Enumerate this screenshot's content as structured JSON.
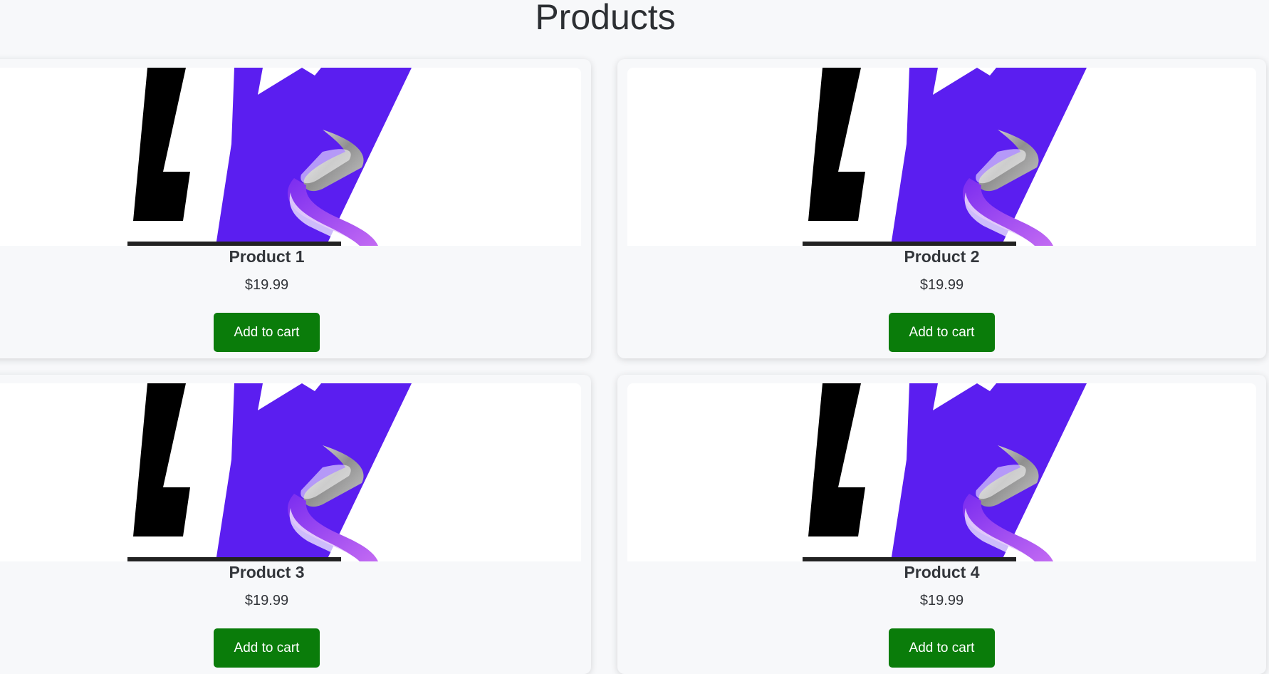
{
  "page": {
    "title": "Products"
  },
  "products": [
    {
      "name": "Product 1",
      "price": "$19.99",
      "button_label": "Add to cart",
      "image_icon": "lw-logo-icon"
    },
    {
      "name": "Product 2",
      "price": "$19.99",
      "button_label": "Add to cart",
      "image_icon": "lw-logo-icon"
    },
    {
      "name": "Product 3",
      "price": "$19.99",
      "button_label": "Add to cart",
      "image_icon": "lw-logo-icon"
    },
    {
      "name": "Product 4",
      "price": "$19.99",
      "button_label": "Add to cart",
      "image_icon": "lw-logo-icon"
    }
  ],
  "colors": {
    "background": "#f7f8fa",
    "button": "#0a7c0a",
    "logo_purple": "#5b1ef0",
    "logo_black": "#000000"
  }
}
